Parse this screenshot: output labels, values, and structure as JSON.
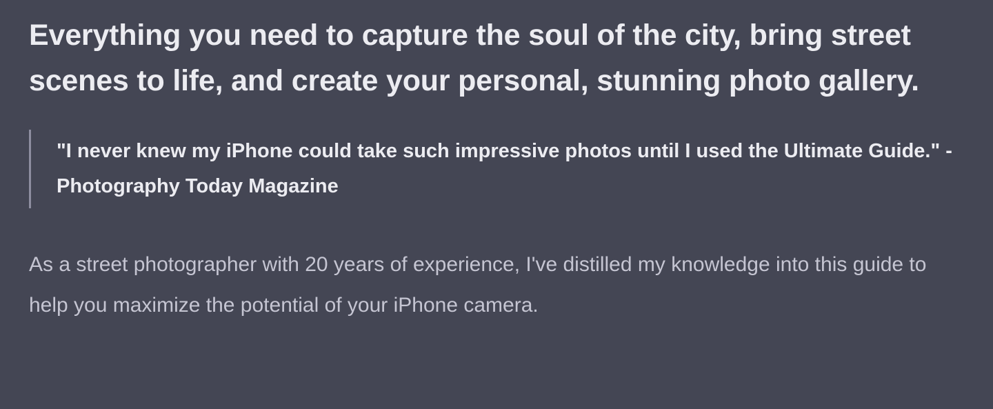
{
  "message": {
    "heading": "Everything you need to capture the soul of the city, bring street scenes to life, and create your personal, stunning photo gallery.",
    "quote": "\"I never knew my iPhone could take such impressive photos until I used the Ultimate Guide.\" - Photography Today Magazine",
    "paragraph": "As a street photographer with 20 years of experience, I've distilled my knowledge into this guide to help you maximize the potential of your iPhone camera."
  },
  "colors": {
    "background": "#444654",
    "heading_text": "#ececf1",
    "body_text": "#c5c5d2",
    "quote_border": "#8e8ea0"
  }
}
